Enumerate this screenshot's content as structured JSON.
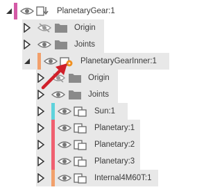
{
  "browser": {
    "rows": [
      {
        "label": "PlanetaryGear:1",
        "toggle": "expanded",
        "object_icon": "component-link-icon",
        "visibility": "visible",
        "color": "#d45aa6"
      },
      {
        "label": "Origin",
        "toggle": "collapsed",
        "object_icon": "folder-icon",
        "visibility": "hidden"
      },
      {
        "label": "Joints",
        "toggle": "collapsed",
        "object_icon": "folder-icon",
        "visibility": "visible"
      },
      {
        "label": "PlanetaryGearInner:1",
        "toggle": "expanded",
        "object_icon": "component-active-icon",
        "visibility": "visible",
        "color": "#f2a06b"
      },
      {
        "label": "Origin",
        "toggle": "collapsed",
        "object_icon": "folder-icon",
        "visibility": "hidden"
      },
      {
        "label": "Joints",
        "toggle": "collapsed",
        "object_icon": "folder-icon",
        "visibility": "visible"
      },
      {
        "label": "Sun:1",
        "toggle": "collapsed",
        "object_icon": "component-icon",
        "visibility": "visible",
        "color": "#5fd3dc"
      },
      {
        "label": "Planetary:1",
        "toggle": "collapsed",
        "object_icon": "component-icon",
        "visibility": "visible",
        "color": "#f06070"
      },
      {
        "label": "Planetary:2",
        "toggle": "collapsed",
        "object_icon": "component-icon",
        "visibility": "visible",
        "color": "#f06070"
      },
      {
        "label": "Planetary:3",
        "toggle": "collapsed",
        "object_icon": "component-icon",
        "visibility": "visible",
        "color": "#f06070"
      },
      {
        "label": "Internal4M60T:1",
        "toggle": "collapsed",
        "object_icon": "component-icon",
        "visibility": "visible",
        "color": "#f2a06b"
      }
    ]
  },
  "annotation": {
    "arrow_color": "#d0202a"
  }
}
